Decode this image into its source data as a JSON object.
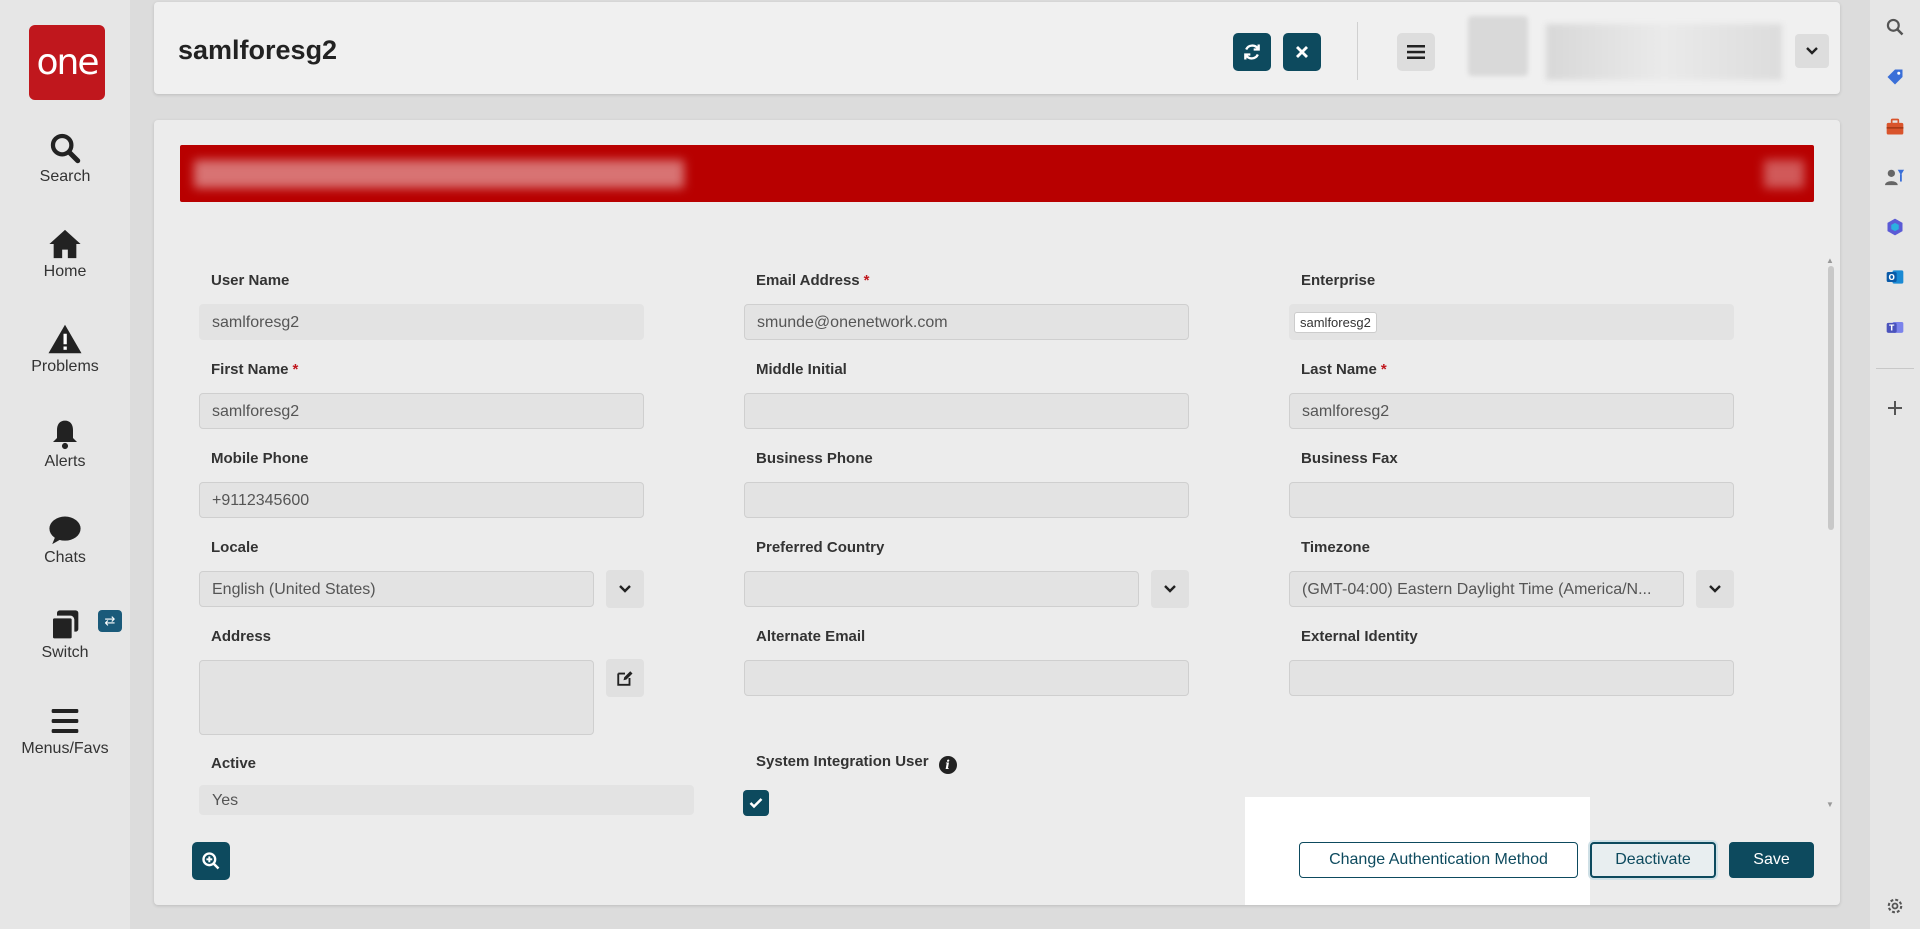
{
  "nav": {
    "logo": "one",
    "items": [
      {
        "label": "Search",
        "icon": "search-icon"
      },
      {
        "label": "Home",
        "icon": "home-icon"
      },
      {
        "label": "Problems",
        "icon": "warning-icon"
      },
      {
        "label": "Alerts",
        "icon": "bell-icon"
      },
      {
        "label": "Chats",
        "icon": "chat-icon"
      },
      {
        "label": "Switch",
        "icon": "switch-icon"
      },
      {
        "label": "Menus/Favs",
        "icon": "menu-icon"
      }
    ]
  },
  "header": {
    "title": "samlforesg2"
  },
  "form": {
    "user_name": {
      "label": "User Name",
      "value": "samlforesg2"
    },
    "email": {
      "label": "Email Address",
      "value": "smunde@onenetwork.com"
    },
    "enterprise": {
      "label": "Enterprise",
      "value": "samlforesg2"
    },
    "first_name": {
      "label": "First Name",
      "value": "samlforesg2"
    },
    "middle_initial": {
      "label": "Middle Initial",
      "value": ""
    },
    "last_name": {
      "label": "Last Name",
      "value": "samlforesg2"
    },
    "mobile_phone": {
      "label": "Mobile Phone",
      "value": "+9112345600"
    },
    "business_phone": {
      "label": "Business Phone",
      "value": ""
    },
    "business_fax": {
      "label": "Business Fax",
      "value": ""
    },
    "locale": {
      "label": "Locale",
      "value": "English (United States)"
    },
    "preferred_country": {
      "label": "Preferred Country",
      "value": ""
    },
    "timezone": {
      "label": "Timezone",
      "value": "(GMT-04:00) Eastern Daylight Time (America/N..."
    },
    "address": {
      "label": "Address",
      "value": ""
    },
    "alternate_email": {
      "label": "Alternate Email",
      "value": ""
    },
    "external_identity": {
      "label": "External Identity",
      "value": ""
    },
    "active": {
      "label": "Active",
      "value": "Yes"
    },
    "system_integration_user": {
      "label": "System Integration User",
      "checked": true
    },
    "required_marker": "*"
  },
  "actions": {
    "change_auth": "Change Authentication Method",
    "deactivate": "Deactivate",
    "save": "Save"
  },
  "colors": {
    "brand": "#c0171d",
    "primary": "#0d4a5e",
    "banner": "#b80000"
  }
}
